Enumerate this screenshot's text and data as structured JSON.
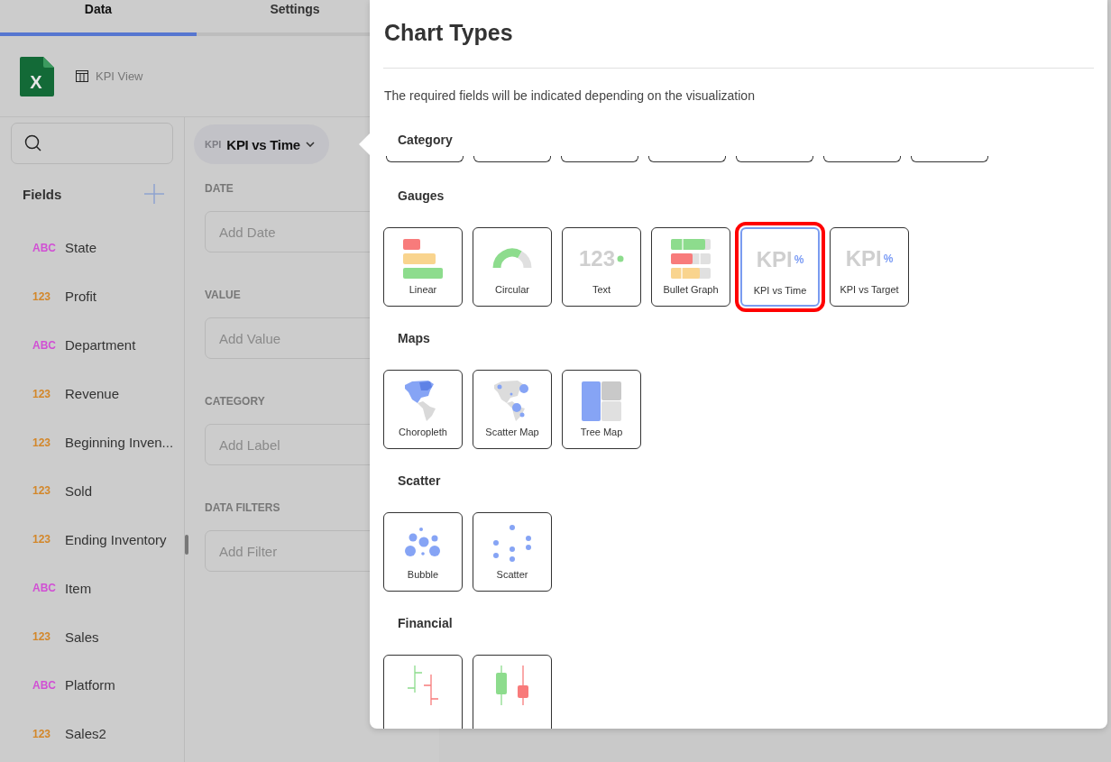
{
  "tabs": [
    {
      "label": "Data",
      "selected": true
    },
    {
      "label": "Settings",
      "selected": false
    }
  ],
  "source": {
    "logo_text": "X",
    "view": "KPI View"
  },
  "fields_panel": {
    "title": "Fields",
    "items": [
      {
        "kind": "text",
        "type_label": "ABC",
        "name": "State"
      },
      {
        "kind": "number",
        "type_label": "123",
        "name": "Profit"
      },
      {
        "kind": "text",
        "type_label": "ABC",
        "name": "Department"
      },
      {
        "kind": "number",
        "type_label": "123",
        "name": "Revenue"
      },
      {
        "kind": "number",
        "type_label": "123",
        "name": "Beginning Inven..."
      },
      {
        "kind": "number",
        "type_label": "123",
        "name": "Sold"
      },
      {
        "kind": "number",
        "type_label": "123",
        "name": "Ending Inventory"
      },
      {
        "kind": "text",
        "type_label": "ABC",
        "name": "Item"
      },
      {
        "kind": "number",
        "type_label": "123",
        "name": "Sales"
      },
      {
        "kind": "text",
        "type_label": "ABC",
        "name": "Platform"
      },
      {
        "kind": "number",
        "type_label": "123",
        "name": "Sales2"
      }
    ]
  },
  "visualization": {
    "icon_text": "KPI",
    "label": "KPI vs Time",
    "sections": [
      {
        "label": "DATE",
        "prompt": "Add Date"
      },
      {
        "label": "VALUE",
        "prompt": "Add Value"
      },
      {
        "label": "CATEGORY",
        "prompt": "Add Label"
      },
      {
        "label": "DATA FILTERS",
        "prompt": "Add Filter"
      }
    ]
  },
  "dialog": {
    "title": "Chart Types",
    "subtitle": "The required fields will be indicated depending on the visualization",
    "groups": [
      {
        "title": "Category",
        "items": [
          {
            "kind": "clipped"
          },
          {
            "kind": "clipped"
          },
          {
            "kind": "clipped"
          },
          {
            "kind": "clipped"
          },
          {
            "kind": "clipped"
          },
          {
            "kind": "clipped"
          },
          {
            "kind": "clipped"
          }
        ]
      },
      {
        "title": "Gauges",
        "items": [
          {
            "kind": "linear",
            "label": "Linear",
            "selected": false
          },
          {
            "kind": "circular",
            "label": "Circular",
            "selected": false
          },
          {
            "kind": "text",
            "label": "Text",
            "icon_text": "123",
            "selected": false
          },
          {
            "kind": "bullet",
            "label": "Bullet Graph",
            "selected": false
          },
          {
            "kind": "kpi",
            "label": "KPI vs Time",
            "icon_text": "KPI",
            "icon_suffix": "%",
            "selected": true
          },
          {
            "kind": "kpi",
            "label": "KPI vs Target",
            "icon_text": "KPI",
            "icon_suffix": "%",
            "selected": false
          }
        ]
      },
      {
        "title": "Maps",
        "items": [
          {
            "kind": "choropleth",
            "label": "Choropleth",
            "selected": false
          },
          {
            "kind": "scatter_map",
            "label": "Scatter Map",
            "selected": false
          },
          {
            "kind": "tree_map",
            "label": "Tree Map",
            "selected": false
          }
        ]
      },
      {
        "title": "Scatter",
        "items": [
          {
            "kind": "bubble",
            "label": "Bubble",
            "selected": false
          },
          {
            "kind": "scatter",
            "label": "Scatter",
            "selected": false
          }
        ]
      },
      {
        "title": "Financial",
        "items": [
          {
            "kind": "ohlc",
            "selected": false
          },
          {
            "kind": "candlestick",
            "selected": false
          }
        ]
      }
    ]
  }
}
